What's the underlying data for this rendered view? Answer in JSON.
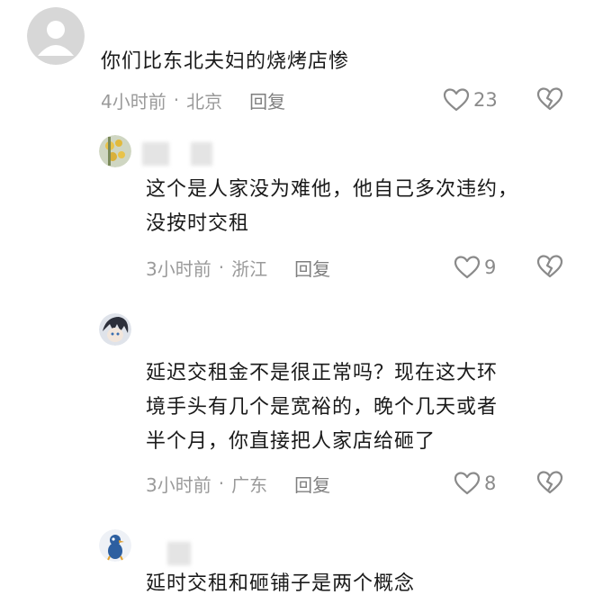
{
  "comments": [
    {
      "text_lines": [
        "你们比东北夫妇的烧烤店惨"
      ],
      "time": "4小时前",
      "location": "北京",
      "reply_label": "回复",
      "likes": "23"
    },
    {
      "text_lines": [
        "这个是人家没为难他，他自己多次违约，",
        "没按时交租"
      ],
      "time": "3小时前",
      "location": "浙江",
      "reply_label": "回复",
      "likes": "9"
    },
    {
      "text_lines": [
        "延迟交租金不是很正常吗？现在这大环",
        "境手头有几个是宽裕的，晚个几天或者",
        "半个月，你直接把人家店给砸了"
      ],
      "time": "3小时前",
      "location": "广东",
      "reply_label": "回复",
      "likes": "8"
    },
    {
      "text_lines": [
        "延时交租和砸铺子是两个概念"
      ]
    }
  ],
  "meta_separator": "·",
  "icons": {
    "like": "heart-outline-icon",
    "dislike": "broken-heart-icon"
  },
  "colors": {
    "text": "#1a1a1a",
    "meta": "#9a9a9a",
    "icon": "#8a8a8a"
  }
}
